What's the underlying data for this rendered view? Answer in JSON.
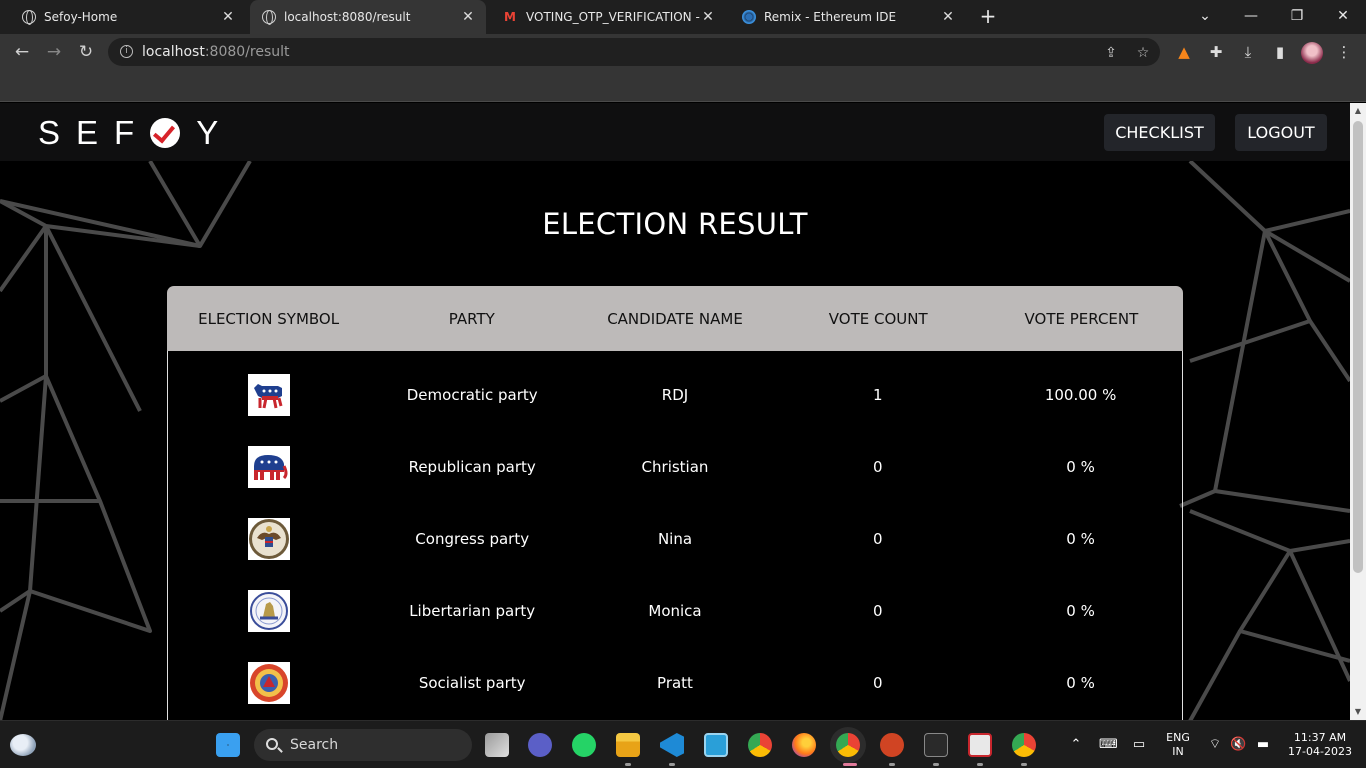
{
  "browser": {
    "tabs": [
      {
        "title": "Sefoy-Home",
        "icon": "globe-icon",
        "active": false
      },
      {
        "title": "localhost:8080/result",
        "icon": "globe-icon",
        "active": true
      },
      {
        "title": "VOTING_OTP_VERIFICATION - shı",
        "icon": "gmail-icon",
        "active": false
      },
      {
        "title": "Remix - Ethereum IDE",
        "icon": "remix-icon",
        "active": false
      }
    ],
    "close_glyph": "✕",
    "new_tab_glyph": "+",
    "url_host": "localhost",
    "url_path": ":8080/result"
  },
  "site": {
    "logo_text_left": "SEF",
    "logo_text_right": "Y",
    "nav": {
      "checklist": "CHECKLIST",
      "logout": "LOGOUT"
    },
    "title": "ELECTION RESULT",
    "accent_color": "#d8232a"
  },
  "table": {
    "headers": [
      "ELECTION SYMBOL",
      "PARTY",
      "CANDIDATE NAME",
      "VOTE COUNT",
      "VOTE PERCENT"
    ],
    "rows": [
      {
        "symbol": "democratic-donkey-icon",
        "party": "Democratic party",
        "candidate": "RDJ",
        "votes": "1",
        "percent": "100.00 %"
      },
      {
        "symbol": "republican-elephant-icon",
        "party": "Republican party",
        "candidate": "Christian",
        "votes": "0",
        "percent": "0 %"
      },
      {
        "symbol": "congress-seal-icon",
        "party": "Congress party",
        "candidate": "Nina",
        "votes": "0",
        "percent": "0 %"
      },
      {
        "symbol": "libertarian-seal-icon",
        "party": "Libertarian party",
        "candidate": "Monica",
        "votes": "0",
        "percent": "0 %"
      },
      {
        "symbol": "socialist-seal-icon",
        "party": "Socialist party",
        "candidate": "Pratt",
        "votes": "0",
        "percent": "0 %"
      }
    ]
  },
  "taskbar": {
    "search_label": "Search",
    "lang_top": "ENG",
    "lang_bottom": "IN",
    "time": "11:37 AM",
    "date": "17-04-2023"
  }
}
